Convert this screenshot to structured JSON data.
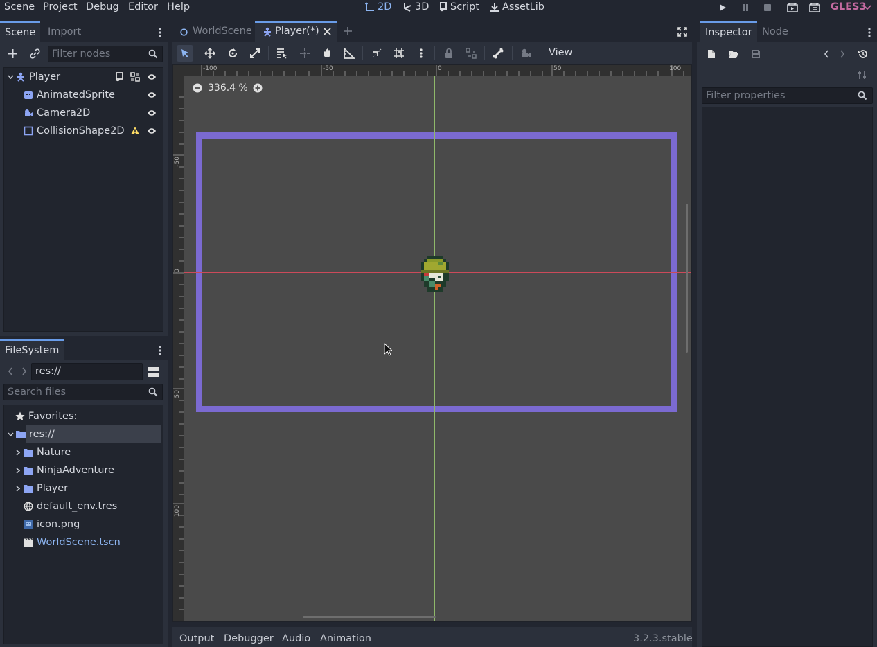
{
  "menubar": {
    "items": [
      "Scene",
      "Project",
      "Debug",
      "Editor",
      "Help"
    ],
    "workspaces": [
      "2D",
      "3D",
      "Script",
      "AssetLib"
    ],
    "renderer": "GLES3"
  },
  "scene_dock": {
    "tabs": [
      "Scene",
      "Import"
    ],
    "filter_placeholder": "Filter nodes",
    "nodes": [
      {
        "name": "Player",
        "icon": "kinematic-body-icon"
      },
      {
        "name": "AnimatedSprite",
        "icon": "animated-sprite-icon"
      },
      {
        "name": "Camera2D",
        "icon": "camera-icon"
      },
      {
        "name": "CollisionShape2D",
        "icon": "collision-shape-icon"
      }
    ]
  },
  "filesystem_dock": {
    "tab": "FileSystem",
    "path": "res://",
    "search_placeholder": "Search files",
    "favorites_label": "Favorites:",
    "items": [
      {
        "name": "res://",
        "type": "folder-root"
      },
      {
        "name": "Nature",
        "type": "folder"
      },
      {
        "name": "NinjaAdventure",
        "type": "folder"
      },
      {
        "name": "Player",
        "type": "folder"
      },
      {
        "name": "default_env.tres",
        "type": "environment"
      },
      {
        "name": "icon.png",
        "type": "image"
      },
      {
        "name": "WorldScene.tscn",
        "type": "scene"
      }
    ]
  },
  "scene_tabs": [
    "WorldScene",
    "Player(*)"
  ],
  "toolbar": {
    "view_label": "View"
  },
  "viewport": {
    "zoom": "336.4 %",
    "ruler_h": [
      "-100",
      "-50",
      "0",
      "50",
      "100"
    ],
    "ruler_v": [
      "-50",
      "0",
      "50",
      "100"
    ]
  },
  "inspector_dock": {
    "tabs": [
      "Inspector",
      "Node"
    ],
    "filter_placeholder": "Filter properties"
  },
  "bottom_panel": {
    "tabs": [
      "Output",
      "Debugger",
      "Audio",
      "Animation"
    ],
    "version": "3.2.3.stable"
  },
  "colors": {
    "accent": "#699ce8",
    "collision_shape": "#7b6ad1",
    "renderer": "#c36aa0",
    "viewport_bg": "#4b4b4b"
  }
}
